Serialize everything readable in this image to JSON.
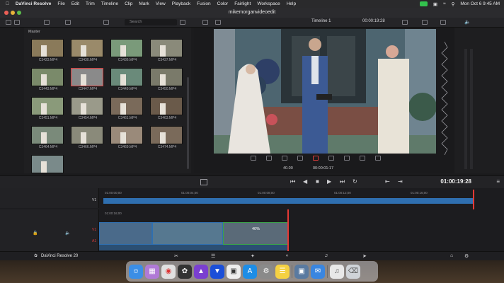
{
  "menubar": {
    "app_name": "DaVinci Resolve",
    "items": [
      "File",
      "Edit",
      "Trim",
      "Timeline",
      "Clip",
      "Mark",
      "View",
      "Playback",
      "Fusion",
      "Color",
      "Fairlight",
      "Workspace",
      "Help"
    ],
    "datetime": "Mon Oct 6  9:45 AM"
  },
  "window": {
    "title": "mikemorganvideoedit"
  },
  "toolbar": {
    "search_placeholder": "Search"
  },
  "media_pool": {
    "folder": "Master",
    "clips": [
      {
        "name": "C3423.MP4",
        "color": "#8a7a5a"
      },
      {
        "name": "C3430.MP4",
        "color": "#9a8a6a"
      },
      {
        "name": "C3436.MP4",
        "color": "#7a9a7a"
      },
      {
        "name": "C3437.MP4",
        "color": "#8a8a7a"
      },
      {
        "name": "C3443.MP4",
        "color": "#7a8a6a"
      },
      {
        "name": "C3447.MP4",
        "color": "#8a8a8a",
        "selected": true
      },
      {
        "name": "C3449.MP4",
        "color": "#6a8a7a"
      },
      {
        "name": "C3450.MP4",
        "color": "#7a7a6a"
      },
      {
        "name": "C3451.MP4",
        "color": "#8a9a7a"
      },
      {
        "name": "C3454.MP4",
        "color": "#9a9a8a"
      },
      {
        "name": "C3461.MP4",
        "color": "#7a6a5a"
      },
      {
        "name": "C3463.MP4",
        "color": "#6a5a4a"
      },
      {
        "name": "C3464.MP4",
        "color": "#7a8a7a"
      },
      {
        "name": "C3466.MP4",
        "color": "#8a8a7a"
      },
      {
        "name": "C3469.MP4",
        "color": "#9a8a7a"
      },
      {
        "name": "C3474.MP4",
        "color": "#7a6a5a"
      },
      {
        "name": "",
        "color": "#7a8a8a"
      }
    ]
  },
  "viewer": {
    "timeline_name": "Timeline 1",
    "timecode": "00:00:19:28",
    "zoom": "40.00",
    "duration": "00:00:01:17"
  },
  "transport": {
    "timecode": "01:00:19:28"
  },
  "timeline": {
    "ruler_top": [
      "01:00:00;00",
      "01:00:04;00",
      "01:00:08;00",
      "01:00:12;00",
      "01:00:16;00"
    ],
    "ruler_bottom": "01:00:16;00",
    "tracks": {
      "v1": "V1",
      "a1": "A1"
    },
    "clip_speed": "40%"
  },
  "pagebar": {
    "product": "DaVinci Resolve 20"
  },
  "colors": {
    "accent": "#d93b3b",
    "playhead": "#e53935",
    "clip_blue": "#2f6fb0",
    "clip_green": "#3aa34a"
  }
}
